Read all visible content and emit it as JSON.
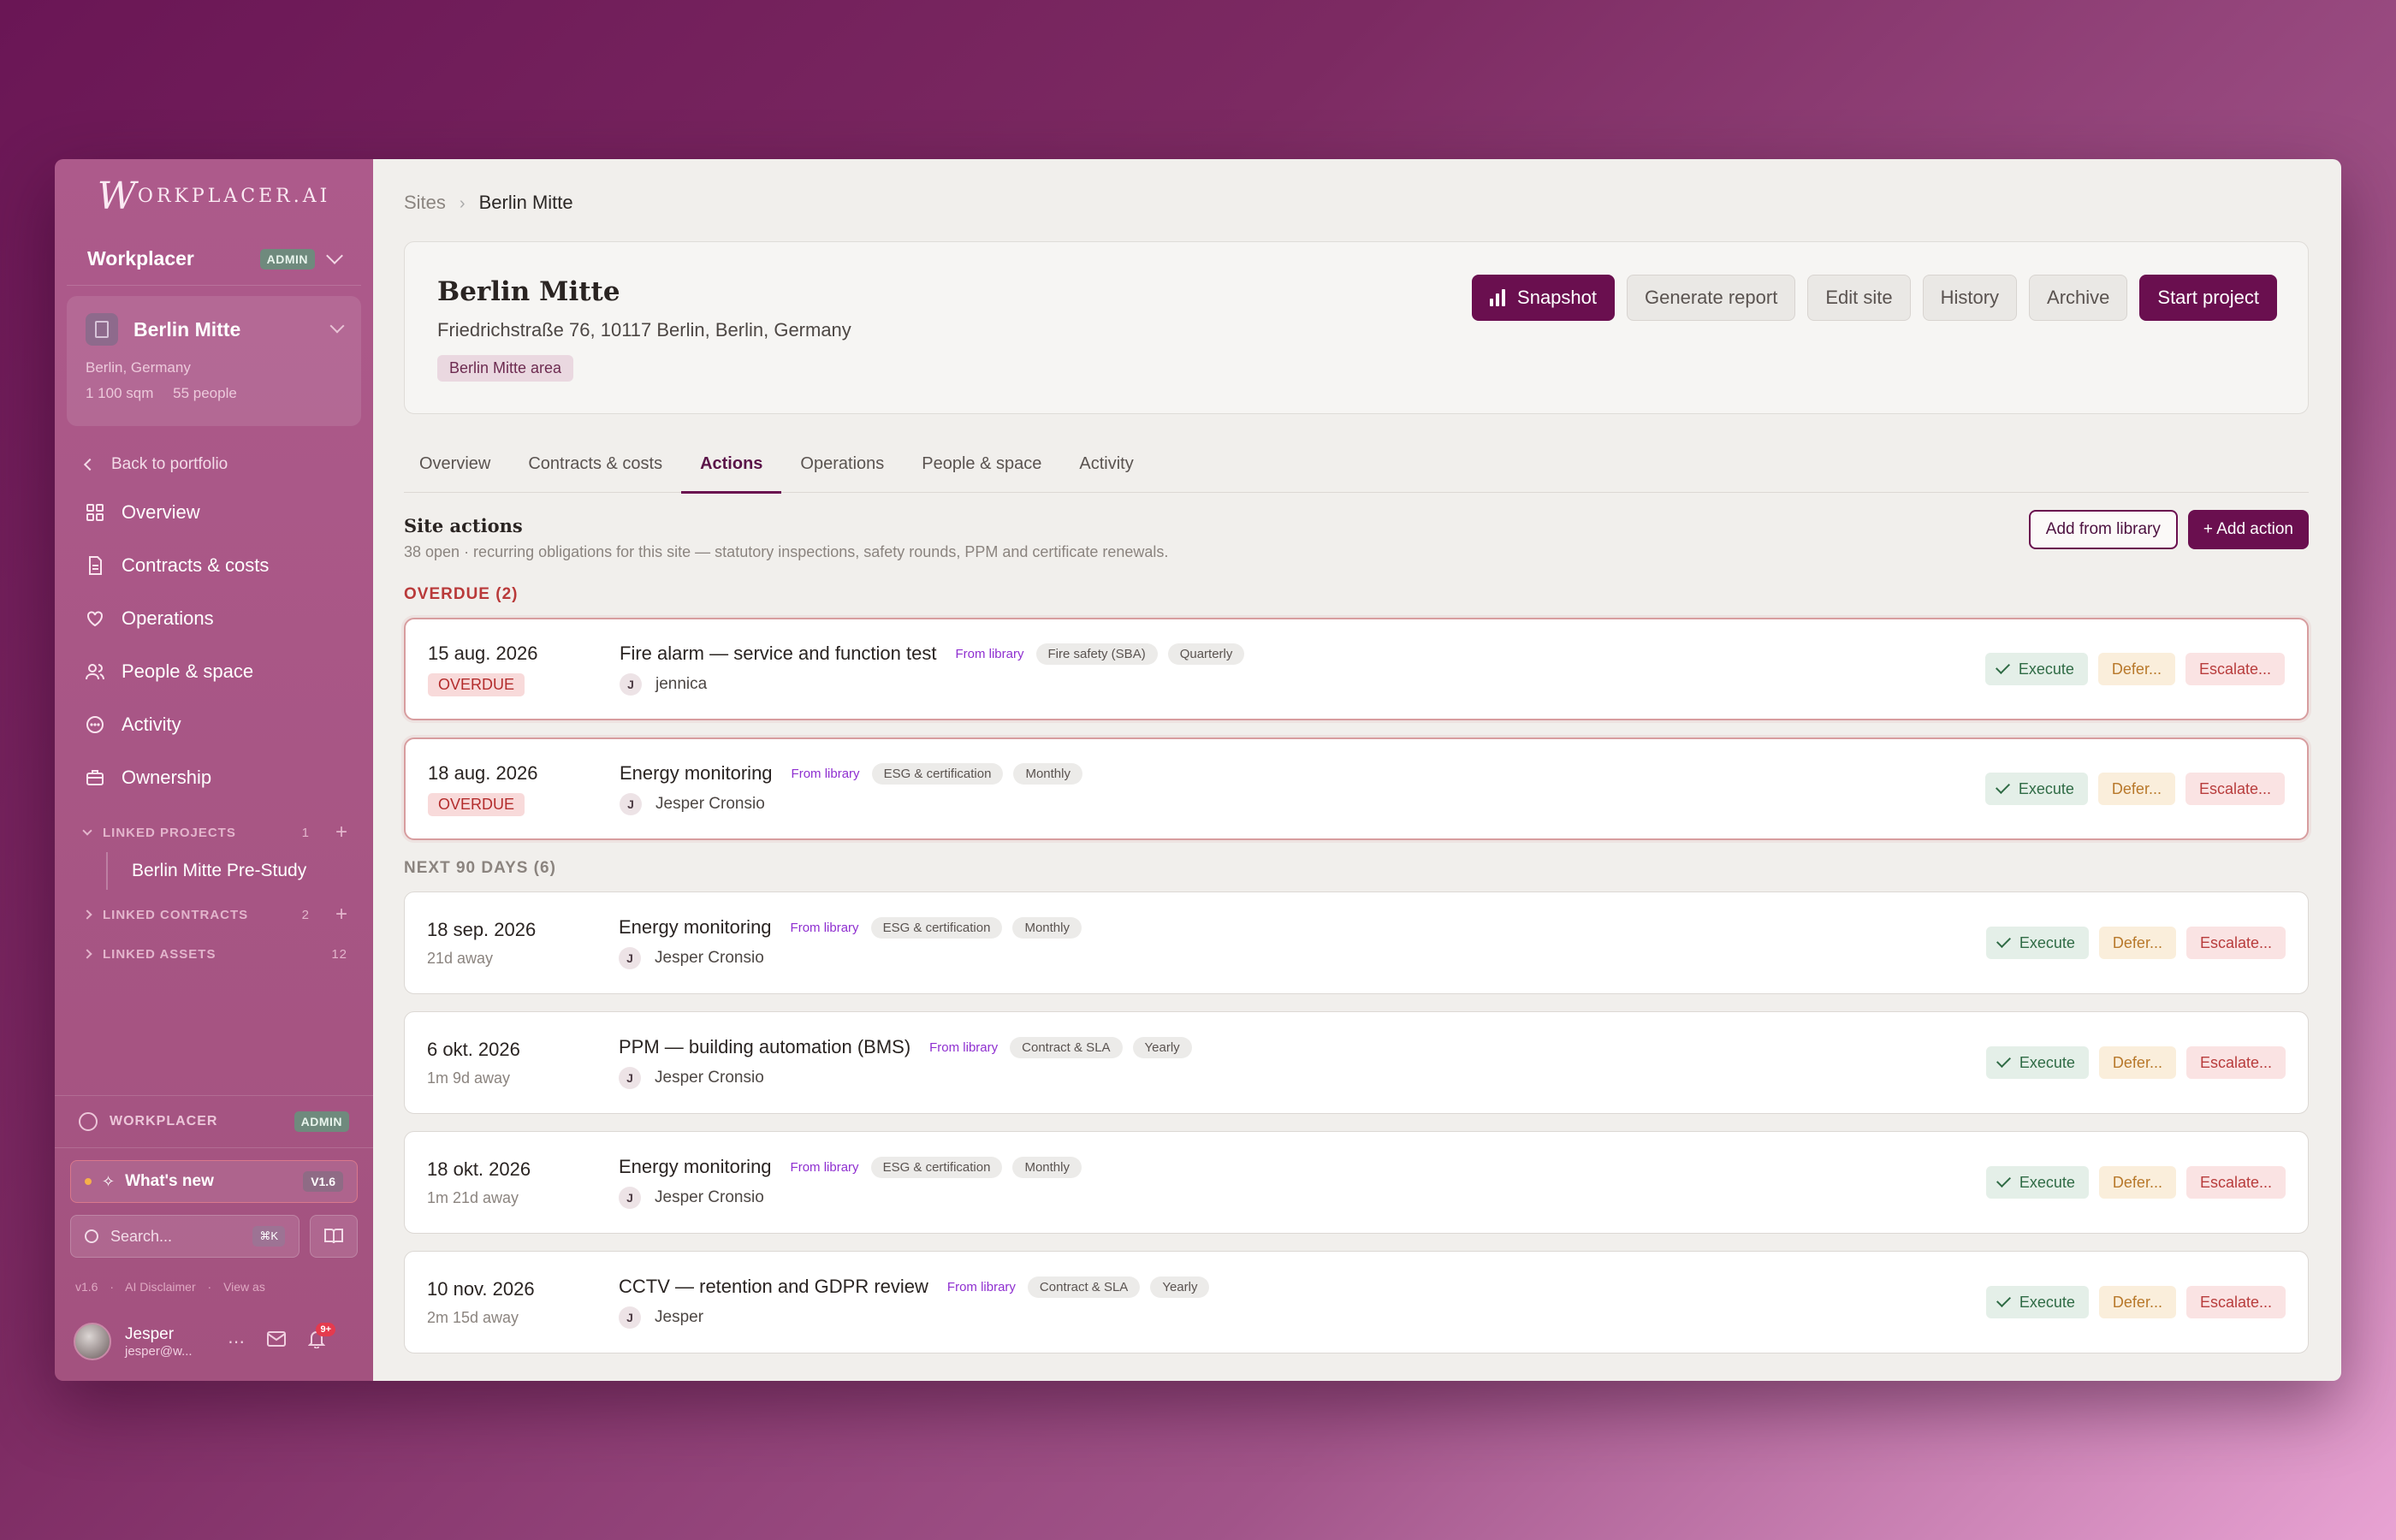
{
  "sidebar": {
    "logo_initial": "W",
    "logo_rest": "ORKPLACER.AI",
    "org_name": "Workplacer",
    "org_badge": "ADMIN",
    "site": {
      "name": "Berlin Mitte",
      "location": "Berlin, Germany",
      "area": "1 100 sqm",
      "people": "55 people"
    },
    "back_label": "Back to portfolio",
    "nav": [
      {
        "label": "Overview",
        "icon": "grid-icon"
      },
      {
        "label": "Contracts & costs",
        "icon": "document-icon"
      },
      {
        "label": "Operations",
        "icon": "heart-check-icon"
      },
      {
        "label": "People & space",
        "icon": "people-icon"
      },
      {
        "label": "Activity",
        "icon": "chat-bubble-icon"
      },
      {
        "label": "Ownership",
        "icon": "briefcase-icon"
      }
    ],
    "linked_projects": {
      "label": "LINKED PROJECTS",
      "count": "1",
      "items": [
        "Berlin Mitte Pre-Study"
      ]
    },
    "linked_contracts": {
      "label": "LINKED CONTRACTS",
      "count": "2"
    },
    "linked_assets": {
      "label": "LINKED ASSETS",
      "count": "12"
    },
    "workspace_label": "WORKPLACER",
    "workspace_badge": "ADMIN",
    "whats_new": "What's new",
    "version_badge": "V1.6",
    "search_placeholder": "Search...",
    "search_shortcut": "⌘K",
    "footer_links": [
      "v1.6",
      "·",
      "AI Disclaimer",
      "·",
      "View as"
    ],
    "user": {
      "name": "Jesper",
      "email": "jesper@w...",
      "notifications": "9+"
    }
  },
  "main": {
    "breadcrumb": {
      "root": "Sites",
      "current": "Berlin Mitte"
    },
    "site_title": "Berlin Mitte",
    "address": "Friedrichstraße 76, 10117 Berlin, Berlin, Germany",
    "area_tag": "Berlin Mitte area",
    "header_buttons": {
      "snapshot": "Snapshot",
      "report": "Generate report",
      "edit": "Edit site",
      "history": "History",
      "archive": "Archive",
      "start": "Start project"
    },
    "tabs": [
      "Overview",
      "Contracts & costs",
      "Actions",
      "Operations",
      "People & space",
      "Activity"
    ],
    "active_tab": "Actions",
    "section_title": "Site actions",
    "section_desc": "38 open · recurring obligations for this site — statutory inspections, safety rounds, PPM and certificate renewals.",
    "add_from_library": "Add from library",
    "add_action": "+ Add action",
    "overdue_label": "OVERDUE (2)",
    "next_label": "NEXT 90 DAYS (6)",
    "overdue_badge": "OVERDUE",
    "from_library": "From library",
    "op_execute": "Execute",
    "op_defer": "Defer...",
    "op_escalate": "Escalate...",
    "overdue_items": [
      {
        "date": "15 aug. 2026",
        "title": "Fire alarm — service and function test",
        "category": "Fire safety (SBA)",
        "freq": "Quarterly",
        "initial": "J",
        "assignee": "jennica"
      },
      {
        "date": "18 aug. 2026",
        "title": "Energy monitoring",
        "category": "ESG & certification",
        "freq": "Monthly",
        "initial": "J",
        "assignee": "Jesper Cronsio"
      }
    ],
    "next_items": [
      {
        "date": "18 sep. 2026",
        "away": "21d away",
        "title": "Energy monitoring",
        "category": "ESG & certification",
        "freq": "Monthly",
        "initial": "J",
        "assignee": "Jesper Cronsio"
      },
      {
        "date": "6 okt. 2026",
        "away": "1m 9d away",
        "title": "PPM — building automation (BMS)",
        "category": "Contract & SLA",
        "freq": "Yearly",
        "initial": "J",
        "assignee": "Jesper Cronsio"
      },
      {
        "date": "18 okt. 2026",
        "away": "1m 21d away",
        "title": "Energy monitoring",
        "category": "ESG & certification",
        "freq": "Monthly",
        "initial": "J",
        "assignee": "Jesper Cronsio"
      },
      {
        "date": "10 nov. 2026",
        "away": "2m 15d away",
        "title": "CCTV — retention and GDPR review",
        "category": "Contract & SLA",
        "freq": "Yearly",
        "initial": "J",
        "assignee": "Jesper"
      }
    ]
  }
}
